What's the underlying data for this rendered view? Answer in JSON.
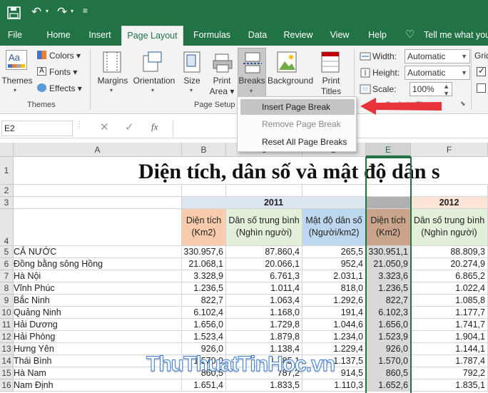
{
  "tabs": [
    "File",
    "Home",
    "Insert",
    "Page Layout",
    "Formulas",
    "Data",
    "Review",
    "View",
    "Help",
    "Tell me what you"
  ],
  "active_tab": "Page Layout",
  "ribbon": {
    "themes_label": "Themes",
    "colors_label": "Colors",
    "fonts_label": "Fonts",
    "effects_label": "Effects",
    "themes_group": "Themes",
    "margins_label": "Margins",
    "orientation_label": "Orientation",
    "size_label": "Size",
    "print_area_l1": "Print",
    "print_area_l2": "Area",
    "breaks_label": "Breaks",
    "background_label": "Background",
    "print_titles_l1": "Print",
    "print_titles_l2": "Titles",
    "page_setup_group": "Page Setup",
    "width_label": "Width:",
    "width_value": "Automatic",
    "height_label": "Height:",
    "height_value": "Automatic",
    "scale_label": "Scale:",
    "scale_value": "100%",
    "scale_fit_partial": "Scale to Fit",
    "gridlines_partial": "Grid"
  },
  "breaks_menu": {
    "insert": "Insert Page Break",
    "remove": "Remove Page Break",
    "reset": "Reset All Page Breaks"
  },
  "formula_bar": {
    "name_box": "E2",
    "fx": "fx"
  },
  "columns": [
    "A",
    "B",
    "C",
    "D",
    "E",
    "F"
  ],
  "rows": [
    "1",
    "2",
    "3",
    "4",
    "5",
    "6",
    "7",
    "8",
    "9",
    "10",
    "11",
    "12",
    "13",
    "14",
    "15",
    "16"
  ],
  "sheet": {
    "title": "Diện tích, dân số và mật độ dân s",
    "year1": "2011",
    "year2": "2012",
    "h_area": "Diện tích (Km2)",
    "h_pop": "Dân số trung bình (Nghìn người)",
    "h_density": "Mật độ dân số (Người/km2)",
    "data": [
      [
        "CẢ NƯỚC",
        "330.957,6",
        "87.860,4",
        "265,5",
        "330.951,1",
        "88.809,3"
      ],
      [
        "Đồng bằng sông Hồng",
        "21.068,1",
        "20.066,1",
        "952,4",
        "21.050,9",
        "20.274,9"
      ],
      [
        "Hà Nội",
        "3.328,9",
        "6.761,3",
        "2.031,1",
        "3.323,6",
        "6.865,2"
      ],
      [
        "Vĩnh Phúc",
        "1.236,5",
        "1.011,4",
        "818,0",
        "1.236,5",
        "1.022,4"
      ],
      [
        "Bắc Ninh",
        "822,7",
        "1.063,4",
        "1.292,6",
        "822,7",
        "1.085,8"
      ],
      [
        "Quảng Ninh",
        "6.102,4",
        "1.168,0",
        "191,4",
        "6.102,3",
        "1.177,7"
      ],
      [
        "Hải Dương",
        "1.656,0",
        "1.729,8",
        "1.044,6",
        "1.656,0",
        "1.741,7"
      ],
      [
        "Hải Phòng",
        "1.523,4",
        "1.879,8",
        "1.234,0",
        "1.523,9",
        "1.904,1"
      ],
      [
        "Hưng Yên",
        "926,0",
        "1.138,4",
        "1.229,4",
        "926,0",
        "1.144,1"
      ],
      [
        "Thái Bình",
        "1.570,0",
        "1.785,1",
        "1.137,5",
        "1.570,0",
        "1.787,4"
      ],
      [
        "Hà Nam",
        "860,5",
        "787,2",
        "914,5",
        "860,5",
        "792,2"
      ],
      [
        "Nam Định",
        "1.651,4",
        "1.833,5",
        "1.110,3",
        "1.652,6",
        "1.835,1"
      ]
    ]
  },
  "watermark": "ThuThuatTinHoc.vn",
  "colors": {
    "accent": "#217346",
    "area_hdr": "#f8cbad",
    "pop_hdr": "#e2efda",
    "dens_hdr": "#bdd7ee",
    "sel_area_hdr": "#c9a48a",
    "year_bar": "#dce6f1",
    "year2_bar": "#fce4d6",
    "arrow": "#e8333b"
  }
}
